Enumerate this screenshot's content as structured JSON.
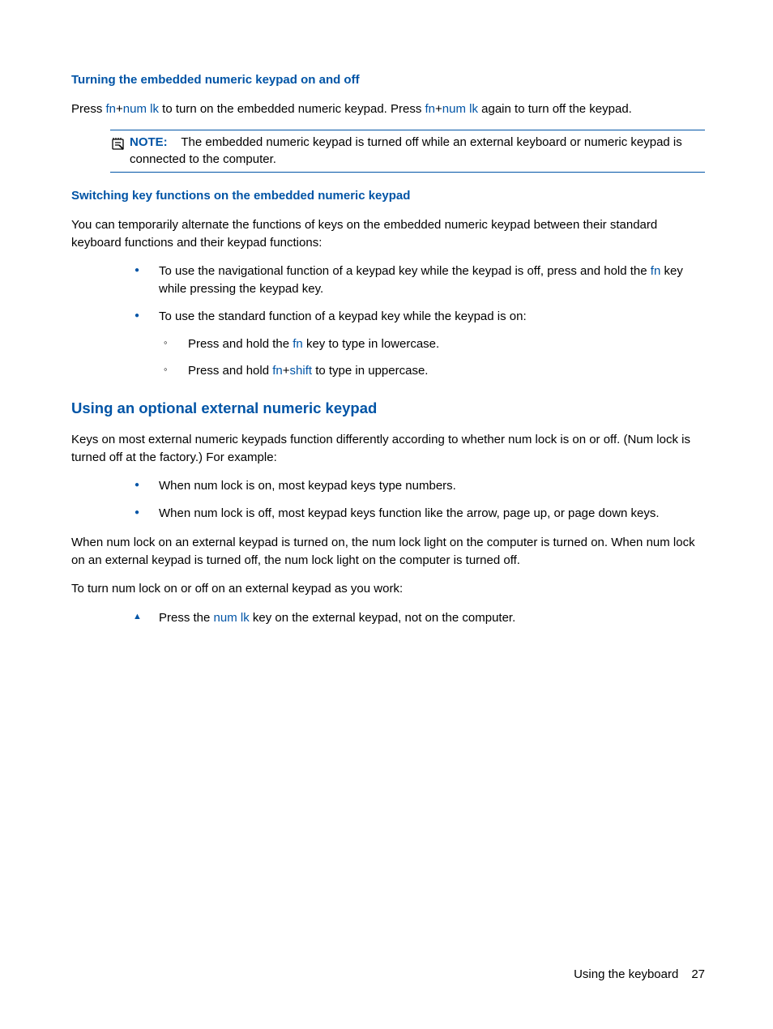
{
  "section1": {
    "heading": "Turning the embedded numeric keypad on and off",
    "p1_a": "Press ",
    "p1_fn1": "fn",
    "p1_plus1": "+",
    "p1_num1": "num lk",
    "p1_b": " to turn on the embedded numeric keypad. Press ",
    "p1_fn2": "fn",
    "p1_plus2": "+",
    "p1_num2": "num lk",
    "p1_c": " again to turn off the keypad.",
    "note_label": "NOTE:",
    "note_text": "The embedded numeric keypad is turned off while an external keyboard or numeric keypad is connected to the computer."
  },
  "section2": {
    "heading": "Switching key functions on the embedded numeric keypad",
    "p1": "You can temporarily alternate the functions of keys on the embedded numeric keypad between their standard keyboard functions and their keypad functions:",
    "b1_a": "To use the navigational function of a keypad key while the keypad is off, press and hold the ",
    "b1_fn": "fn",
    "b1_b": " key while pressing the keypad key.",
    "b2": "To use the standard function of a keypad key while the keypad is on:",
    "b2_s1_a": "Press and hold the ",
    "b2_s1_fn": "fn",
    "b2_s1_b": " key to type in lowercase.",
    "b2_s2_a": "Press and hold ",
    "b2_s2_fn": "fn",
    "b2_s2_plus": "+",
    "b2_s2_shift": "shift",
    "b2_s2_b": " to type in uppercase."
  },
  "section3": {
    "heading": "Using an optional external numeric keypad",
    "p1": "Keys on most external numeric keypads function differently according to whether num lock is on or off. (Num lock is turned off at the factory.) For example:",
    "b1": "When num lock is on, most keypad keys type numbers.",
    "b2": "When num lock is off, most keypad keys function like the arrow, page up, or page down keys.",
    "p2": "When num lock on an external keypad is turned on, the num lock light on the computer is turned on. When num lock on an external keypad is turned off, the num lock light on the computer is turned off.",
    "p3": "To turn num lock on or off on an external keypad as you work:",
    "t1_a": "Press the ",
    "t1_num": "num lk",
    "t1_b": " key on the external keypad, not on the computer."
  },
  "footer": {
    "title": "Using the keyboard",
    "page": "27"
  }
}
